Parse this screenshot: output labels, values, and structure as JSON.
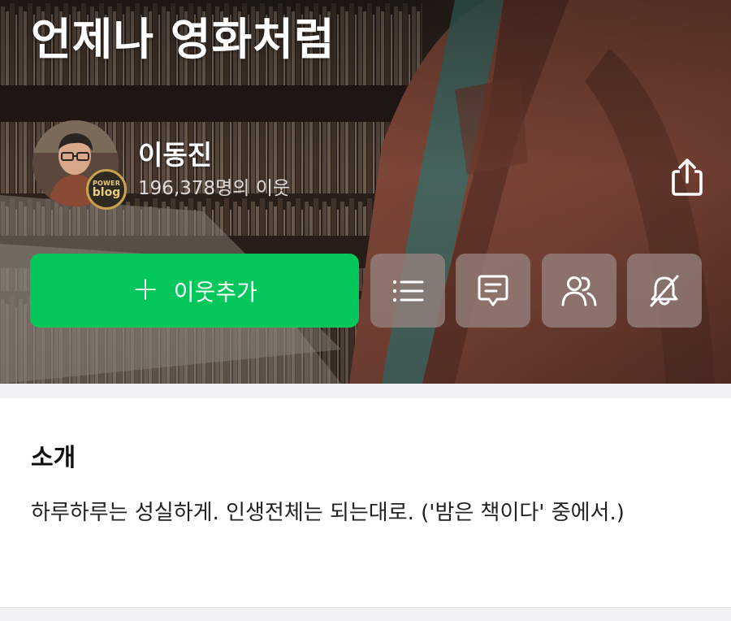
{
  "blog": {
    "title": "언제나 영화처럼"
  },
  "profile": {
    "name": "이동진",
    "neighbors": "196,378명의 이웃",
    "badge_line1": "POWER",
    "badge_line2": "blog"
  },
  "actions": {
    "add_neighbor_label": "이웃추가",
    "share_icon": "share-icon",
    "list_icon": "list-icon",
    "message_icon": "message-icon",
    "neighbors_icon": "people-icon",
    "notifications_icon": "bell-off-icon"
  },
  "intro": {
    "heading": "소개",
    "text": "하루하루는 성실하게. 인생전체는 되는대로. ('밤은 책이다' 중에서.)"
  },
  "colors": {
    "accent_green": "#03c75a",
    "icon_button_bg": "#96827e"
  }
}
